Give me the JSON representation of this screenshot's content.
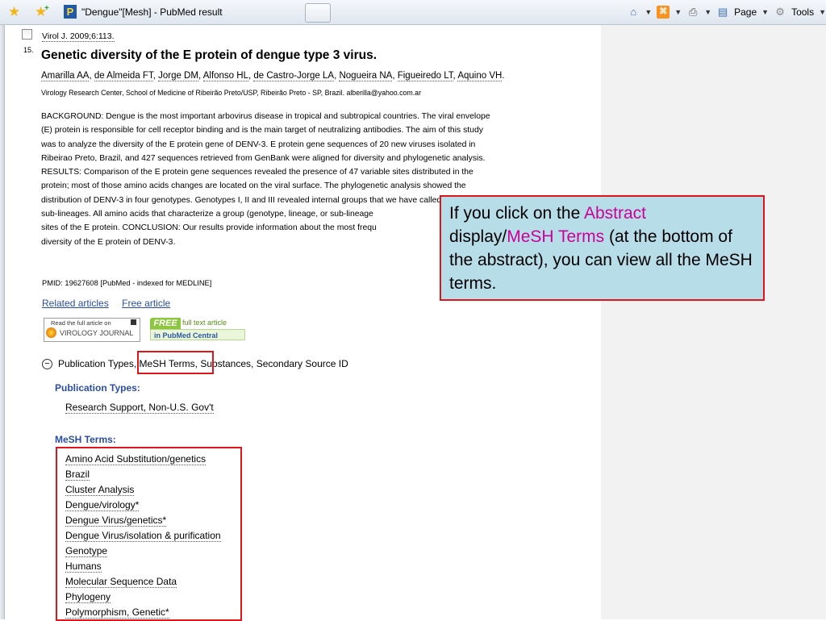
{
  "toolbar": {
    "tab_title": "\"Dengue\"[Mesh] - PubMed result",
    "tab_favicon_letter": "P",
    "page_label": "Page",
    "tools_label": "Tools"
  },
  "article": {
    "citation": "Virol J. 2009;6:113.",
    "item_number": "15.",
    "title": "Genetic diversity of the E protein of dengue type 3 virus.",
    "authors": [
      "Amarilla AA",
      "de Almeida FT",
      "Jorge DM",
      "Alfonso HL",
      "de Castro-Jorge LA",
      "Nogueira NA",
      "Figueiredo LT",
      "Aquino VH"
    ],
    "affiliation": "Virology Research Center, School of Medicine of Ribeirão Preto/USP, Ribeirão Preto - SP, Brazil. alberilla@yahoo.com.ar",
    "abstract_lines": [
      "BACKGROUND: Dengue is the most important arbovirus disease in tropical and subtropical countries. The viral envelope",
      "(E) protein is responsible for cell receptor binding and is the main target of neutralizing antibodies. The aim of this study",
      "was to analyze the diversity of the E protein gene of DENV-3. E protein gene sequences of 20 new viruses isolated in",
      "Ribeirao Preto, Brazil, and 427 sequences retrieved from GenBank were aligned for diversity and phylogenetic analysis.",
      "RESULTS: Comparison of the E protein gene sequences revealed the presence of 47 variable sites distributed in the",
      "protein; most of those amino acids changes are located on the viral surface. The phylogenetic analysis showed the",
      "distribution of DENV-3 in four genotypes. Genotypes I, II and III revealed internal groups that we have called",
      "sub-lineages. All amino acids that characterize a group (genotype, lineage, or sub-lineage",
      "sites of the E protein. CONCLUSION: Our results provide information about the most frequ",
      "diversity of the E protein of DENV-3."
    ],
    "pmid": "PMID: 19627608 [PubMed - indexed for MEDLINE]",
    "related_articles": "Related articles",
    "free_article": "Free article",
    "vj_badge_top": "Read the full article on",
    "vj_badge_name": "VIROLOGY JOURNAL",
    "pmc_free": "FREE",
    "pmc_full_text": "full text article",
    "pmc_bottom": "in PubMed Central"
  },
  "discovery": {
    "pub_types": "Publication Types",
    "mesh_terms": "MeSH Terms",
    "rest": "Substances, Secondary Source ID"
  },
  "publication_types": {
    "heading": "Publication Types:",
    "items": [
      "Research Support, Non-U.S. Gov't"
    ]
  },
  "mesh": {
    "heading": "MeSH Terms:",
    "items": [
      "Amino Acid Substitution/genetics",
      "Brazil",
      "Cluster Analysis",
      "Dengue/virology*",
      "Dengue Virus/genetics*",
      "Dengue Virus/isolation & purification",
      "Genotype",
      "Humans",
      "Molecular Sequence Data",
      "Phylogeny",
      "Polymorphism, Genetic*"
    ]
  },
  "callout": {
    "t1": "If you click on the ",
    "t2": "Abstract",
    "t3": " display/",
    "t4": "MeSH Terms",
    "t5": " (at the bottom of the abstract), you can view all the MeSH terms."
  },
  "colors": {
    "accent_red": "#e0151b",
    "callout_bg": "#b7dde8",
    "highlight_magenta": "#cc0099",
    "link_blue": "#2a4da3"
  }
}
